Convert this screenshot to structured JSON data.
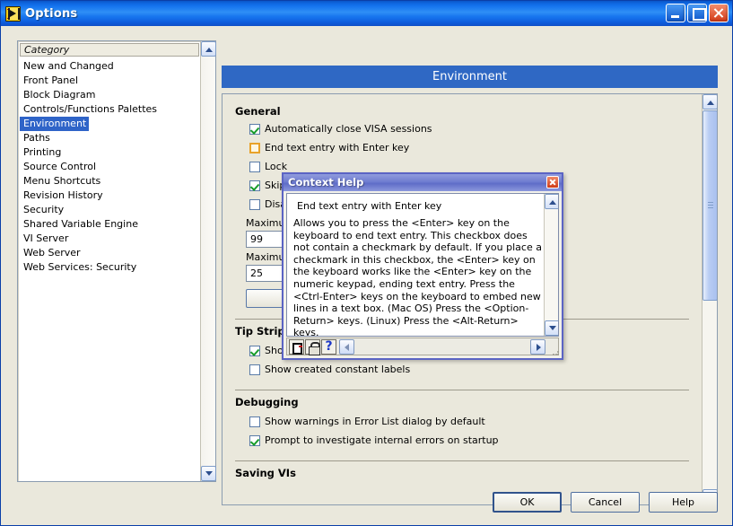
{
  "window": {
    "title": "Options",
    "icon": "labview-icon",
    "controls": {
      "minimize": "minimize-button",
      "maximize": "maximize-button",
      "close": "close-button"
    }
  },
  "category_list": {
    "header": "Category",
    "selected": "Environment",
    "items": [
      "New and Changed",
      "Front Panel",
      "Block Diagram",
      "Controls/Functions Palettes",
      "Environment",
      "Paths",
      "Printing",
      "Source Control",
      "Menu Shortcuts",
      "Revision History",
      "Security",
      "Shared Variable Engine",
      "VI Server",
      "Web Server",
      "Web Services: Security"
    ]
  },
  "panel": {
    "header": "Environment",
    "sections": [
      {
        "title": "General",
        "checkboxes": [
          {
            "label": "Automatically close VISA sessions",
            "checked": true,
            "focused": false
          },
          {
            "label": "End text entry with Enter key",
            "checked": false,
            "focused": true
          },
          {
            "label": "Lock ",
            "checked": false,
            "focused": false,
            "clipped": true
          },
          {
            "label": "Skip ",
            "checked": true,
            "focused": false,
            "clipped": true
          },
          {
            "label": "Disab",
            "checked": false,
            "focused": false,
            "clipped": true
          }
        ],
        "numerics": [
          {
            "label": "Maximum",
            "value": "99",
            "clipped": true
          },
          {
            "label": "Maximum",
            "value": "25",
            "clipped": true
          }
        ]
      },
      {
        "title": "Tip Strips a",
        "title_clipped": true,
        "checkboxes": [
          {
            "label": "Show tip strips",
            "checked": true,
            "focused": false
          },
          {
            "label": "Show created constant labels",
            "checked": false,
            "focused": false
          }
        ]
      },
      {
        "title": "Debugging",
        "checkboxes": [
          {
            "label": "Show warnings in Error List dialog by default",
            "checked": false,
            "focused": false
          },
          {
            "label": "Prompt to investigate internal errors on startup",
            "checked": true,
            "focused": false
          }
        ]
      },
      {
        "title": "Saving VIs",
        "title_clipped": true,
        "checkboxes": []
      }
    ]
  },
  "context_help": {
    "title": "Context Help",
    "heading": "End text entry with Enter key",
    "body": "Allows you to press the <Enter> key on the keyboard to end text entry. This checkbox does not contain a checkmark by default. If you place a checkmark in this checkbox, the <Enter> key on the keyboard works like the <Enter> key on the numeric keypad, ending text entry. Press the <Ctrl-Enter> keys on the keyboard to embed new lines in a text box. (Mac OS) Press the <Option-Return> keys. (Linux) Press the <Alt-Return> keys.",
    "toolbar": {
      "show_optional_terminals": "terminals-icon",
      "lock": "lock-icon",
      "detailed_help": "question-mark-icon",
      "back": "back-arrow-icon",
      "forward": "forward-arrow-icon"
    },
    "close": "close-button"
  },
  "footer": {
    "ok": "OK",
    "cancel": "Cancel",
    "help": "Help"
  },
  "colors": {
    "title_bar_blue": "#1473ee",
    "header_blue": "#2f68c4",
    "dialog_background": "#eae8dc",
    "selection_blue": "#2f64c8",
    "context_help_purple": "#6f7dd0",
    "checkmark_green": "#179c2a",
    "focus_orange": "#e8a22a"
  }
}
